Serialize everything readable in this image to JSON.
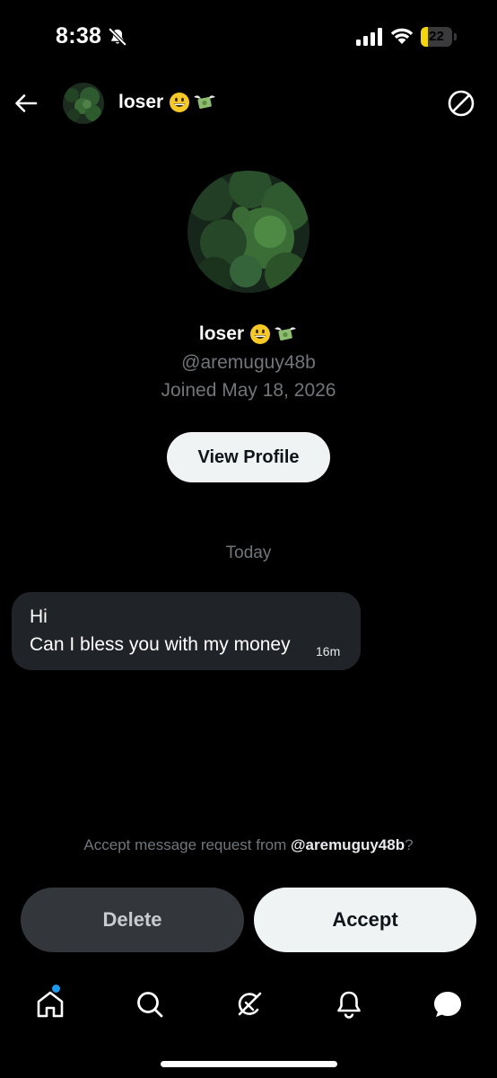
{
  "status_bar": {
    "time": "8:38",
    "battery_level": "22",
    "battery_fraction": 0.22,
    "icons": [
      "bell-slash-icon",
      "cellular-signal-icon",
      "wifi-icon",
      "battery-icon"
    ]
  },
  "header": {
    "name": "loser",
    "icons": [
      "back-arrow-icon",
      "avatar",
      "grinning-face-emoji",
      "money-with-wings-emoji",
      "block-icon"
    ]
  },
  "profile": {
    "name": "loser",
    "handle": "@aremuguy48b",
    "joined": "Joined May 18, 2026",
    "view_profile_label": "View Profile"
  },
  "conversation": {
    "date_divider": "Today",
    "message": {
      "line1": "Hi",
      "line2": "Can I bless you with my money",
      "time": "16m"
    }
  },
  "request": {
    "prefix": "Accept message request from ",
    "handle": "@aremuguy48b",
    "suffix": "?",
    "delete_label": "Delete",
    "accept_label": "Accept"
  },
  "tab_bar": {
    "tabs": [
      "home-icon",
      "search-icon",
      "grok-icon",
      "notifications-icon",
      "messages-icon"
    ],
    "home_has_unread_dot": true
  },
  "colors": {
    "background": "#000000",
    "secondary_text": "#71767b",
    "bubble": "#202327",
    "button_light": "#eff3f4",
    "button_dark": "#33363a",
    "accent_blue": "#1d9bf0",
    "battery_yellow": "#f5d60a"
  }
}
